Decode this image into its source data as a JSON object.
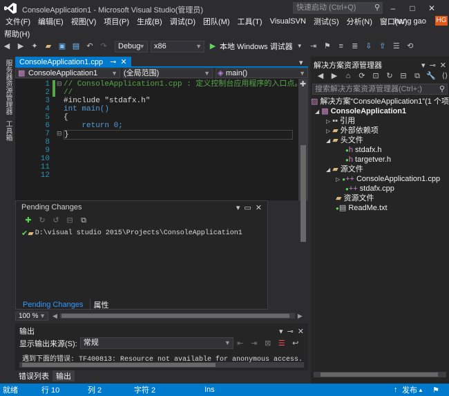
{
  "window": {
    "title": "ConsoleApplication1 - Microsoft Visual Studio(管理员)",
    "quick_launch": "快速启动 (Ctrl+Q)",
    "user": "hang gao",
    "user_badge": "HG"
  },
  "menu": [
    "文件(F)",
    "编辑(E)",
    "视图(V)",
    "项目(P)",
    "生成(B)",
    "调试(D)",
    "团队(M)",
    "工具(T)",
    "VisualSVN",
    "测试(S)",
    "分析(N)",
    "窗口(W)"
  ],
  "menu2": "帮助(H)",
  "toolbar": {
    "config": "Debug",
    "platform": "x86",
    "run_label": "本地 Windows 调试器"
  },
  "left_strip": {
    "server_explorer": "服务器资源管理器",
    "toolbox": "工具箱"
  },
  "editor": {
    "tab": "ConsoleApplication1.cpp",
    "nav_project": "ConsoleApplication1",
    "nav_scope": "(全局范围)",
    "nav_member": "main()",
    "line_numbers": [
      "1",
      "2",
      "3",
      "4",
      "5",
      "6",
      "7",
      "8",
      "9",
      "10",
      "11",
      "12"
    ],
    "lines": [
      "// ConsoleApplication1.cpp : 定义控制台应用程序的入口点。",
      "//",
      "",
      "#include \"stdafx.h\"",
      "",
      "",
      "int main()",
      "{",
      "    return 0;",
      "}",
      "",
      ""
    ],
    "zoom": "100 %"
  },
  "pending": {
    "title": "Pending Changes",
    "path": "D:\\visual studio 2015\\Projects\\ConsoleApplication1",
    "tab1": "Pending Changes",
    "tab2": "属性"
  },
  "output": {
    "title": "输出",
    "source_label": "显示输出来源(S):",
    "source_value": "常规",
    "line": "遇到下面的错误: TF400813: Resource not available for anonymous access. Client authentication"
  },
  "bottom_tabs": {
    "errors": "错误列表",
    "output": "输出"
  },
  "solution": {
    "title": "解决方案资源管理器",
    "search": "搜索解决方案资源管理器(Ctrl+;)",
    "items": [
      {
        "label": "解决方案“ConsoleApplication1”(1 个项"
      },
      {
        "label": "ConsoleApplication1"
      },
      {
        "label": "引用"
      },
      {
        "label": "外部依赖项"
      },
      {
        "label": "头文件"
      },
      {
        "label": "stdafx.h"
      },
      {
        "label": "targetver.h"
      },
      {
        "label": "源文件"
      },
      {
        "label": "ConsoleApplication1.cpp"
      },
      {
        "label": "stdafx.cpp"
      },
      {
        "label": "资源文件"
      },
      {
        "label": "ReadMe.txt"
      }
    ]
  },
  "statusbar": {
    "state": "就绪",
    "line": "行 10",
    "col": "列 2",
    "char": "字符 2",
    "mode": "Ins",
    "publish": "发布"
  }
}
